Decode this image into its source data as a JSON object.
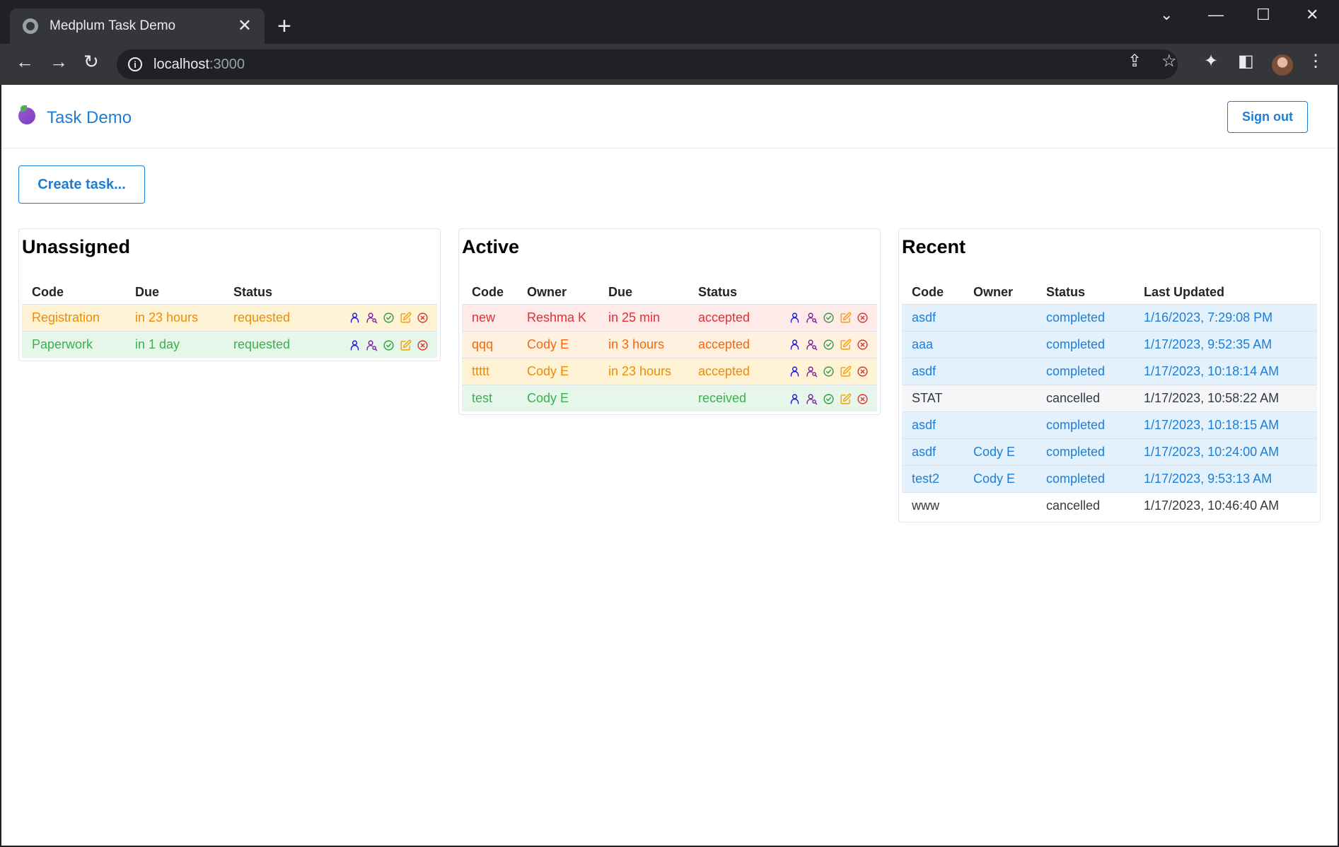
{
  "browser": {
    "tab_title": "Medplum Task Demo",
    "url_host": "localhost",
    "url_port": ":3000"
  },
  "app": {
    "title": "Task Demo",
    "sign_out_label": "Sign out",
    "create_task_label": "Create task..."
  },
  "unassigned": {
    "heading": "Unassigned",
    "columns": [
      "Code",
      "Due",
      "Status"
    ],
    "rows": [
      {
        "code": "Registration",
        "due": "in 23 hours",
        "status": "requested",
        "tone": "orange"
      },
      {
        "code": "Paperwork",
        "due": "in 1 day",
        "status": "requested",
        "tone": "green"
      }
    ]
  },
  "active": {
    "heading": "Active",
    "columns": [
      "Code",
      "Owner",
      "Due",
      "Status"
    ],
    "rows": [
      {
        "code": "new",
        "owner": "Reshma K",
        "due": "in 25 min",
        "status": "accepted",
        "tone": "red"
      },
      {
        "code": "qqq",
        "owner": "Cody E",
        "due": "in 3 hours",
        "status": "accepted",
        "tone": "ltorange"
      },
      {
        "code": "ttttt",
        "owner": "Cody E",
        "due": "in 23 hours",
        "status": "accepted",
        "tone": "orange"
      },
      {
        "code": "test",
        "owner": "Cody E",
        "due": "",
        "status": "received",
        "tone": "green"
      }
    ]
  },
  "recent": {
    "heading": "Recent",
    "columns": [
      "Code",
      "Owner",
      "Status",
      "Last Updated"
    ],
    "rows": [
      {
        "code": "asdf",
        "owner": "",
        "status": "completed",
        "updated": "1/16/2023, 7:29:08 PM",
        "tone": "blue"
      },
      {
        "code": "aaa",
        "owner": "",
        "status": "completed",
        "updated": "1/17/2023, 9:52:35 AM",
        "tone": "blue"
      },
      {
        "code": "asdf",
        "owner": "",
        "status": "completed",
        "updated": "1/17/2023, 10:18:14 AM",
        "tone": "blue"
      },
      {
        "code": "STAT",
        "owner": "",
        "status": "cancelled",
        "updated": "1/17/2023, 10:58:22 AM",
        "tone": "gray"
      },
      {
        "code": "asdf",
        "owner": "",
        "status": "completed",
        "updated": "1/17/2023, 10:18:15 AM",
        "tone": "blue"
      },
      {
        "code": "asdf",
        "owner": "Cody E",
        "status": "completed",
        "updated": "1/17/2023, 10:24:00 AM",
        "tone": "blue"
      },
      {
        "code": "test2",
        "owner": "Cody E",
        "status": "completed",
        "updated": "1/17/2023, 9:53:13 AM",
        "tone": "blue"
      },
      {
        "code": "www",
        "owner": "",
        "status": "cancelled",
        "updated": "1/17/2023, 10:46:40 AM",
        "tone": "white"
      }
    ]
  },
  "action_icons": [
    {
      "name": "assign-user-icon",
      "color": "#1c1ccf"
    },
    {
      "name": "search-user-icon",
      "color": "#7b1fa2"
    },
    {
      "name": "complete-check-icon",
      "color": "#2f9e44"
    },
    {
      "name": "edit-icon",
      "color": "#f59f00"
    },
    {
      "name": "cancel-icon",
      "color": "#e03131"
    }
  ]
}
